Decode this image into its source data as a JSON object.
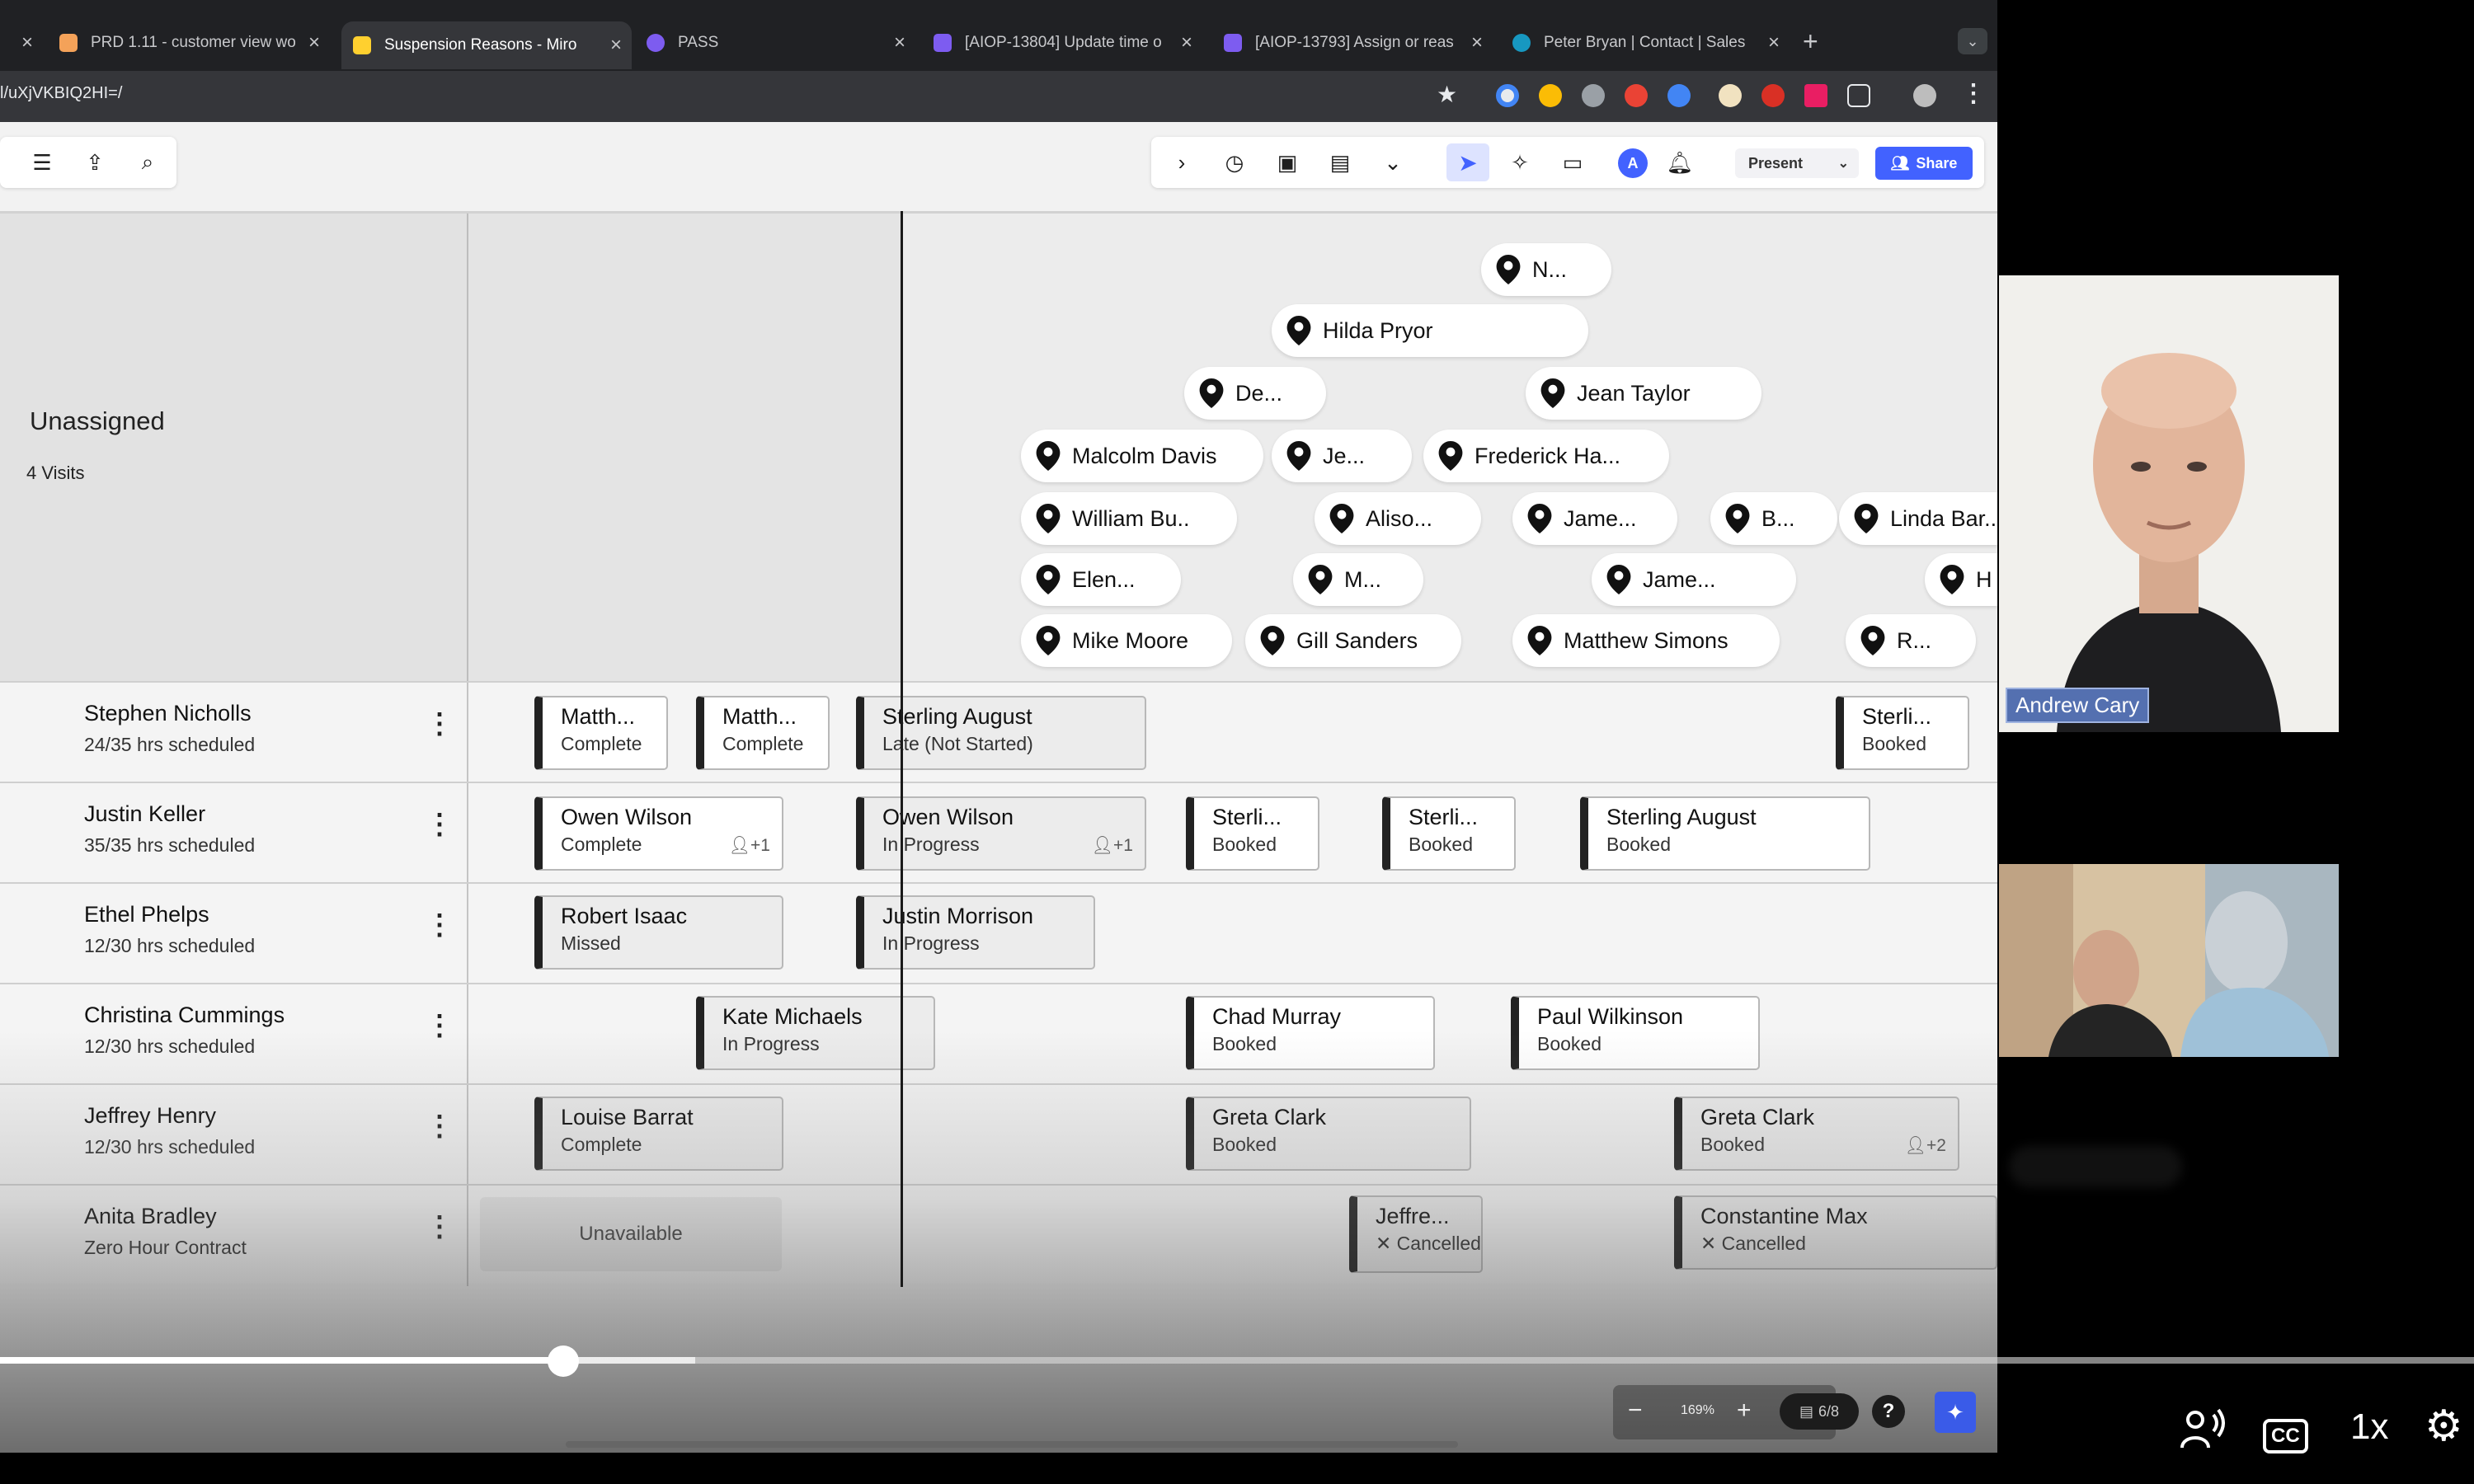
{
  "browser": {
    "tabs": [
      {
        "title": "x",
        "active": false
      },
      {
        "title": "PRD 1.11 - customer view wo",
        "active": false,
        "favicon_color": "#f4a259"
      },
      {
        "title": "Suspension Reasons - Miro",
        "active": true,
        "favicon_color": "#ffd02f"
      },
      {
        "title": "PASS",
        "active": false,
        "favicon_color": "#7d5cf0"
      },
      {
        "title": "[AIOP-13804] Update time o",
        "active": false,
        "favicon_color": "#7d5cf0"
      },
      {
        "title": "[AIOP-13793] Assign or reas",
        "active": false,
        "favicon_color": "#7d5cf0"
      },
      {
        "title": "Peter Bryan | Contact | Sales",
        "active": false,
        "favicon_color": "#1798c1"
      }
    ],
    "new_tab": "+",
    "tab_menu": "⌄",
    "url": "l/uXjVKBIQ2HI=/",
    "star_icon": "★"
  },
  "miro": {
    "present_label": "Present",
    "share_label": "Share",
    "avatar_letter": "A",
    "accent_color": "#4262ff"
  },
  "unassigned": {
    "title": "Unassigned",
    "count": "4 Visits"
  },
  "pins": [
    "N...",
    "Hilda Pryor",
    "De...",
    "Jean Taylor",
    "Malcolm Davis",
    "Je...",
    "Frederick Ha...",
    "William Bu..",
    "Aliso...",
    "Jame...",
    "B...",
    "Linda Bar...",
    "Elen...",
    "M...",
    "Jame...",
    "H",
    "Mike Moore",
    "Gill Sanders",
    "Matthew Simons",
    "R..."
  ],
  "staff": [
    {
      "name": "Stephen Nicholls",
      "hours": "24/35 hrs scheduled"
    },
    {
      "name": "Justin Keller",
      "hours": "35/35 hrs scheduled"
    },
    {
      "name": "Ethel Phelps",
      "hours": "12/30 hrs scheduled"
    },
    {
      "name": "Christina Cummings",
      "hours": "12/30 hrs scheduled"
    },
    {
      "name": "Jeffrey Henry",
      "hours": "12/30 hrs scheduled"
    },
    {
      "name": "Anita Bradley",
      "hours": "Zero Hour Contract"
    }
  ],
  "visits": [
    {
      "name": "Matth...",
      "status": "Complete",
      "extra": ""
    },
    {
      "name": "Matth...",
      "status": "Complete",
      "extra": ""
    },
    {
      "name": "Sterling August",
      "status": "Late (Not Started)",
      "extra": ""
    },
    {
      "name": "Sterli...",
      "status": "Booked",
      "extra": ""
    },
    {
      "name": "Owen Wilson",
      "status": "Complete",
      "extra": "+1"
    },
    {
      "name": "Owen Wilson",
      "status": "In Progress",
      "extra": "+1"
    },
    {
      "name": "Sterli...",
      "status": "Booked",
      "extra": ""
    },
    {
      "name": "Sterli...",
      "status": "Booked",
      "extra": ""
    },
    {
      "name": "Sterling August",
      "status": "Booked",
      "extra": ""
    },
    {
      "name": "Robert Isaac",
      "status": "Missed",
      "extra": ""
    },
    {
      "name": "Justin Morrison",
      "status": "In Progress",
      "extra": ""
    },
    {
      "name": "Kate Michaels",
      "status": "In Progress",
      "extra": ""
    },
    {
      "name": "Chad Murray",
      "status": "Booked",
      "extra": ""
    },
    {
      "name": "Paul Wilkinson",
      "status": "Booked",
      "extra": ""
    },
    {
      "name": "Louise Barrat",
      "status": "Complete",
      "extra": ""
    },
    {
      "name": "Greta Clark",
      "status": "Booked",
      "extra": ""
    },
    {
      "name": "Greta Clark",
      "status": "Booked",
      "extra": "+2"
    },
    {
      "name": "Jeffre...",
      "status": "Cancelled",
      "extra": ""
    },
    {
      "name": "Constantine Max",
      "status": "Cancelled",
      "extra": ""
    }
  ],
  "unavailable_label": "Unavailable",
  "zoom": {
    "minus": "−",
    "value": "169%",
    "plus": "+",
    "pages": "6/8",
    "help": "?"
  },
  "player": {
    "progress": 0.228,
    "buffered": 0.281,
    "speed": "1x",
    "cc": "CC"
  },
  "participants": [
    {
      "name": "Andrew Cary"
    }
  ]
}
